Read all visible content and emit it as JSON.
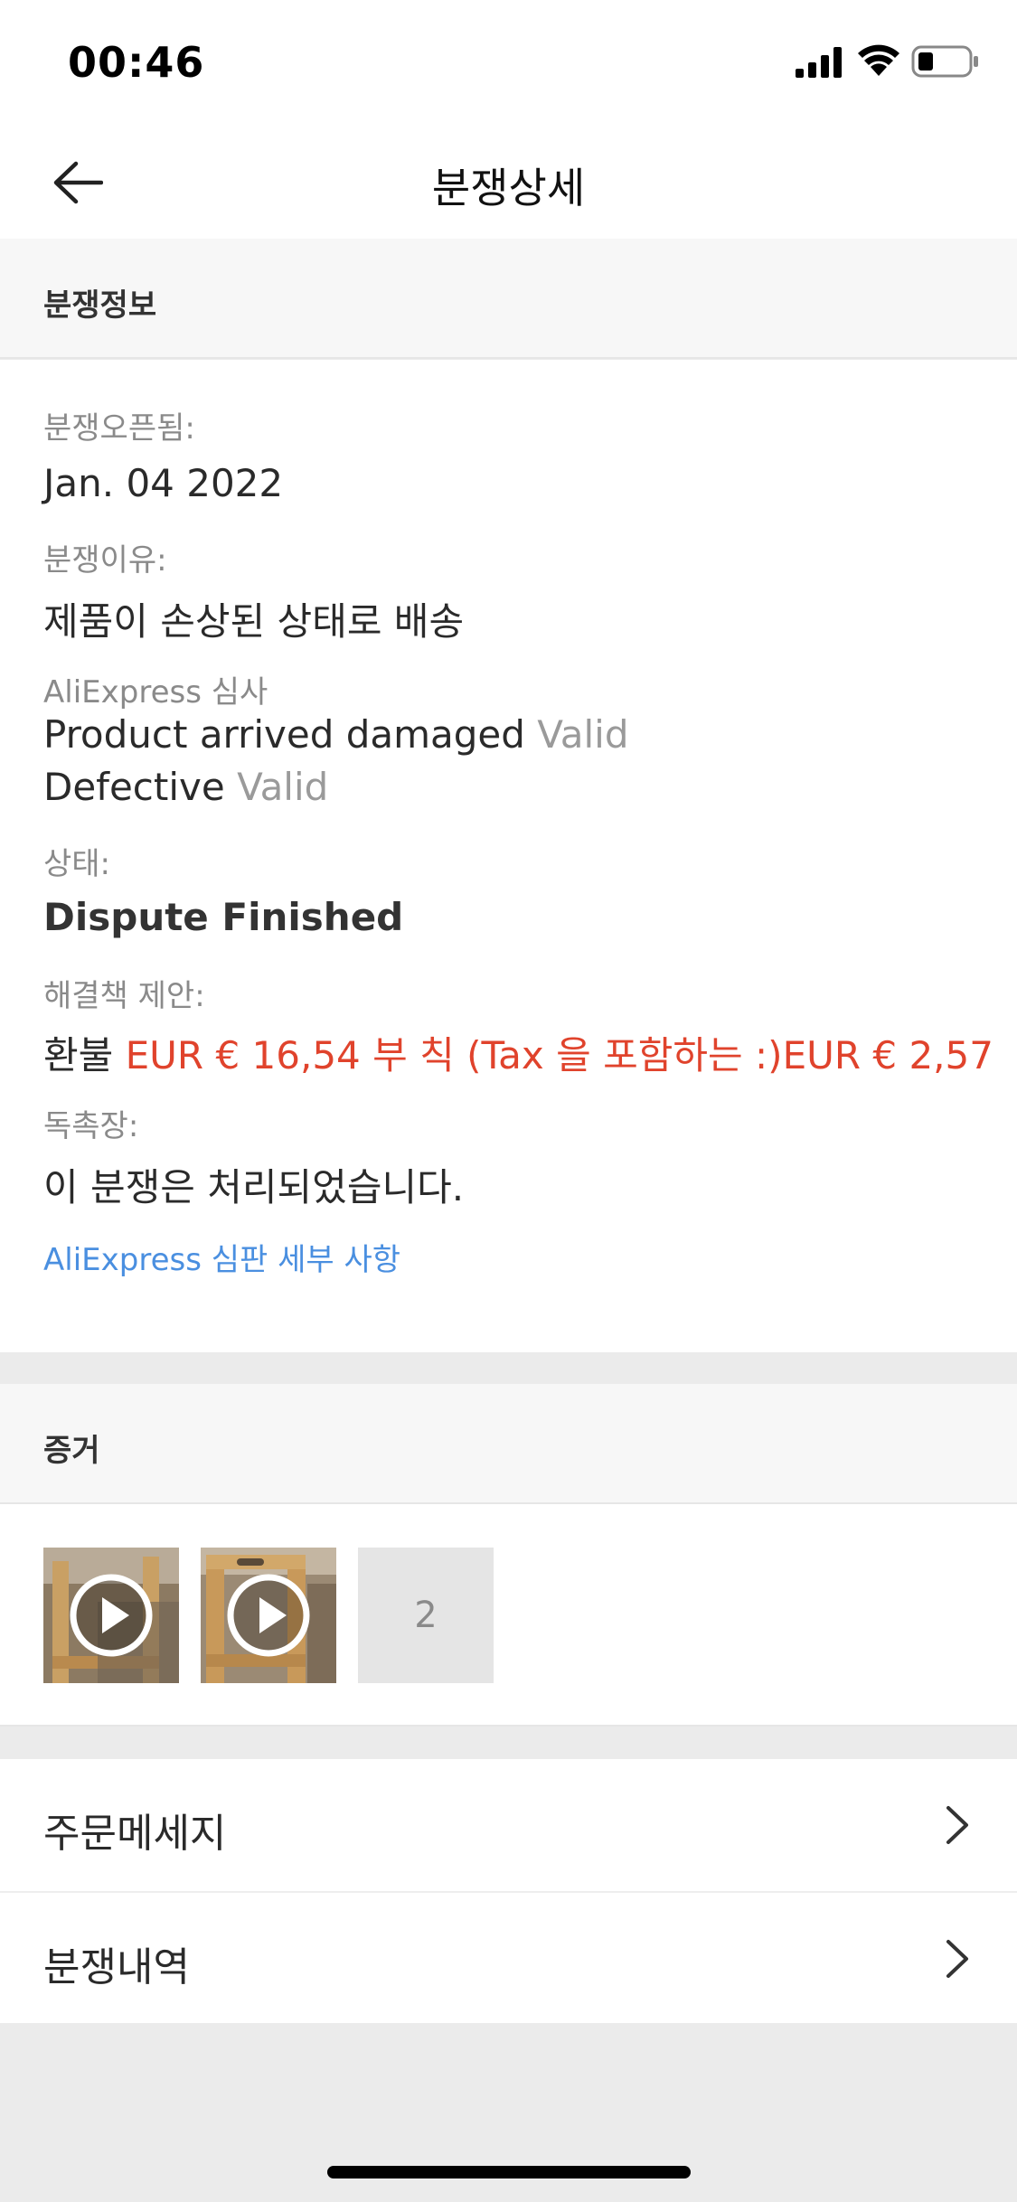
{
  "status_bar": {
    "time": "00:46"
  },
  "nav": {
    "title": "분쟁상세"
  },
  "info": {
    "header": "분쟁정보",
    "opened_label": "분쟁오픈됨:",
    "opened_value": "Jan. 04 2022",
    "reason_label": "분쟁이유:",
    "reason_value": "제품이 손상된 상태로 배송",
    "review_label": "AliExpress 심사",
    "review_items": [
      {
        "text": "Product arrived damaged",
        "verdict": "Valid"
      },
      {
        "text": "Defective",
        "verdict": "Valid"
      }
    ],
    "status_label": "상태:",
    "status_value": "Dispute Finished",
    "solution_label": "해결책 제안:",
    "solution_prefix": "환불",
    "solution_amount": "EUR € 16,54 부 칙 (Tax 을 포함하는 :)EUR € 2,57",
    "verdict_label": "독촉장:",
    "verdict_value": "이 분쟁은 처리되었습니다.",
    "details_link": "AliExpress 심판 세부 사항"
  },
  "evidence": {
    "header": "증거",
    "count": "2"
  },
  "menu": {
    "items": [
      {
        "label": "주문메세지"
      },
      {
        "label": "분쟁내역"
      }
    ]
  },
  "colors": {
    "accent_red": "#e0432c",
    "link_blue": "#4a8fe0"
  }
}
